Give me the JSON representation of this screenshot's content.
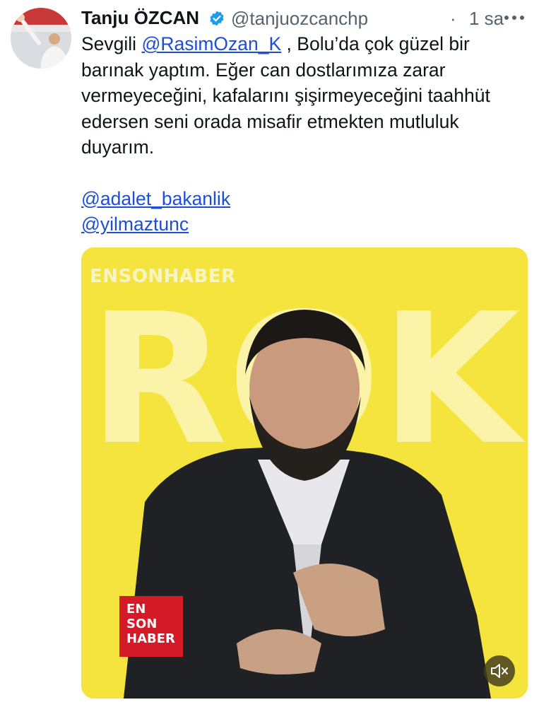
{
  "tweet": {
    "author_name": "Tanju ÖZCAN",
    "author_handle": "@tanjuozcanchp",
    "separator": "·",
    "time": "1 sa",
    "text_prefix": "Sevgili ",
    "mention_1": "@RasimOzan_K",
    "text_body": " , Bolu’da çok güzel bir barınak yaptım. Eğer can dostlarımıza zarar vermeyeceğini, kafalarını şişirmeyeceğini taahhüt edersen seni orada misafir etmekten mutluluk duyarım.",
    "mention_2": "@adalet_bakanlik",
    "mention_3": "@yilmaztunc",
    "icons": {
      "verified": "verified-badge-icon",
      "more": "more-options-icon",
      "mute": "volume-muted-icon"
    }
  },
  "media": {
    "watermark": "ENSONHABER",
    "big_text": "ROK",
    "badge_lines": [
      "EN",
      "SON",
      "HABER"
    ]
  },
  "colors": {
    "link": "#1d4ed8",
    "verified": "#1d9bf0",
    "media_bg": "#f5e43e",
    "badge": "#d41a26"
  }
}
